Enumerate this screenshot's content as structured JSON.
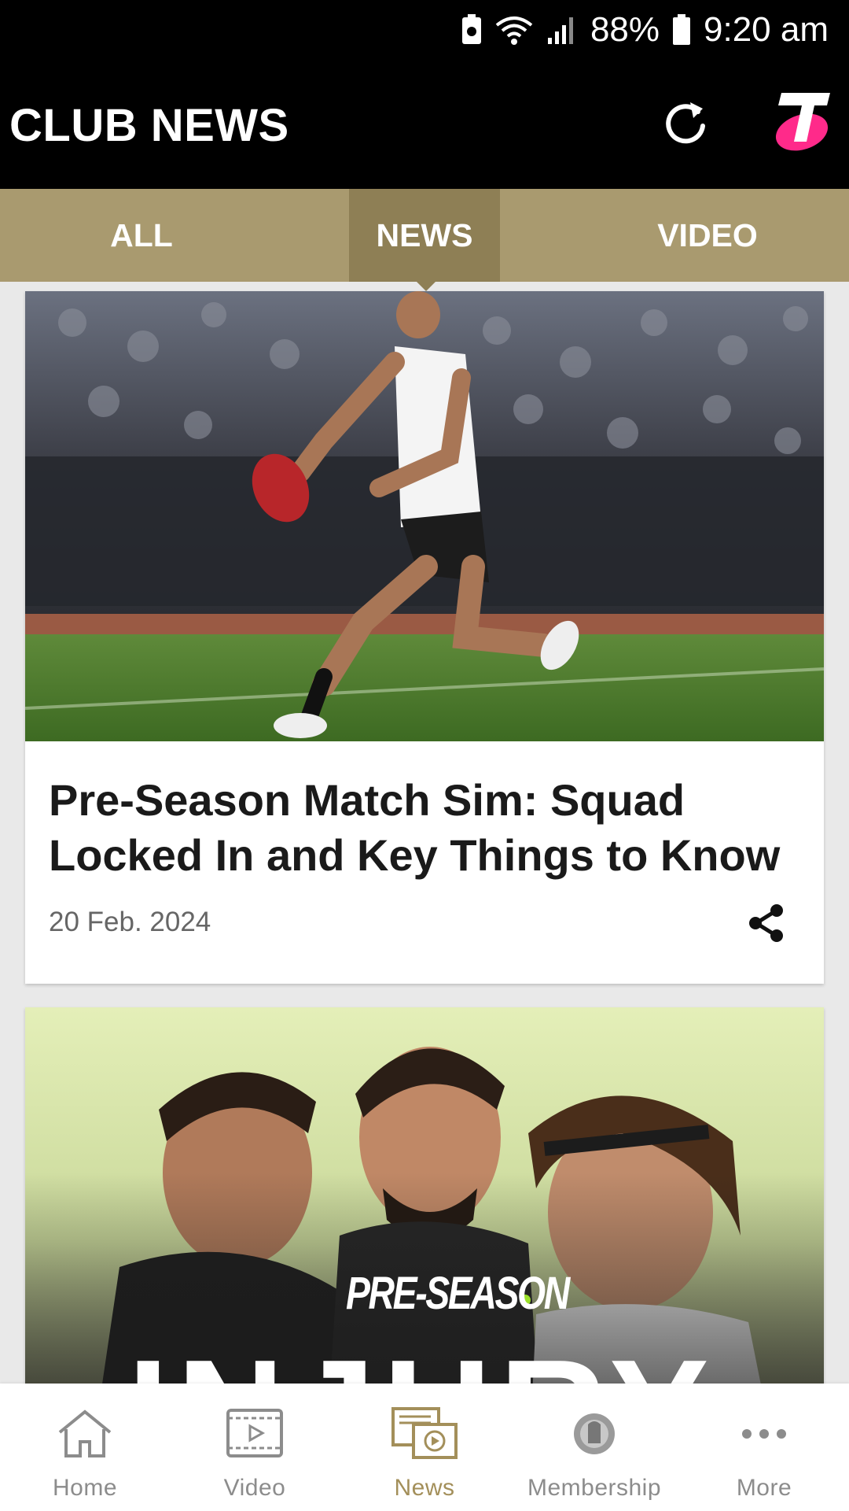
{
  "status_bar": {
    "battery": "88%",
    "time": "9:20 am",
    "icons": [
      "notification-icon",
      "wifi-icon",
      "signal-icon",
      "battery-icon"
    ]
  },
  "header": {
    "title": "CLUB NEWS",
    "refresh_icon": "refresh-icon",
    "logo": "telstra-logo"
  },
  "tabs": [
    {
      "label": "ALL",
      "active": false
    },
    {
      "label": "NEWS",
      "active": true
    },
    {
      "label": "VIDEO",
      "active": false
    }
  ],
  "articles": [
    {
      "title": "Pre-Season Match Sim: Squad Locked In and Key Things to Know",
      "date": "20 Feb. 2024",
      "share_icon": "share-icon"
    },
    {
      "image_caption_small": "PRE-SEASON",
      "image_caption_large": "INJURY"
    }
  ],
  "bottom_nav": [
    {
      "label": "Home",
      "icon": "home-icon",
      "active": false
    },
    {
      "label": "Video",
      "icon": "video-icon",
      "active": false
    },
    {
      "label": "News",
      "icon": "news-icon",
      "active": true
    },
    {
      "label": "Membership",
      "icon": "membership-icon",
      "active": false
    },
    {
      "label": "More",
      "icon": "more-icon",
      "active": false
    }
  ],
  "colors": {
    "header_bg": "#000000",
    "tab_bg": "#a99a6f",
    "tab_active_bg": "#8e7f55",
    "accent": "#a38f5a",
    "logo_pink": "#ff2a8a"
  }
}
